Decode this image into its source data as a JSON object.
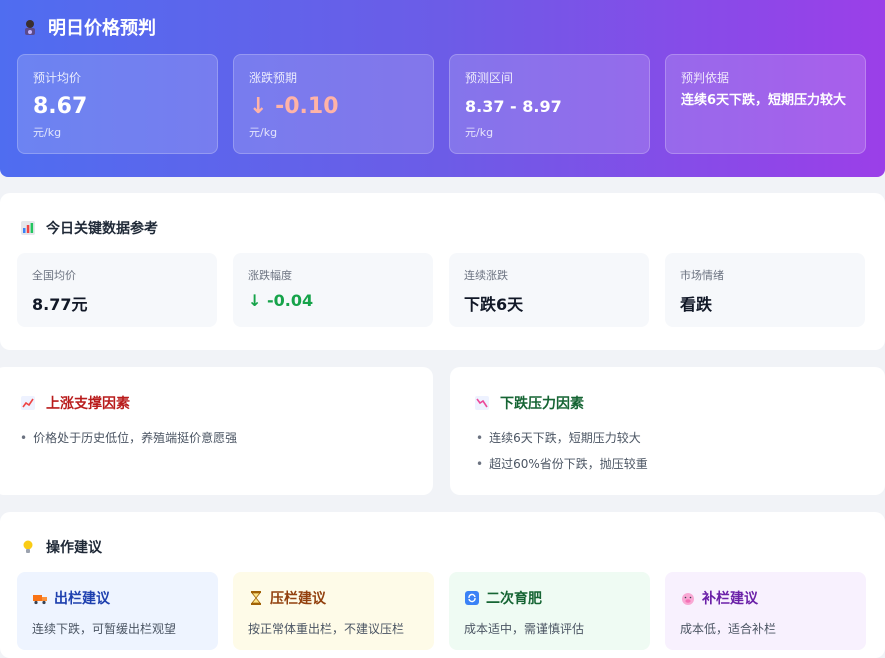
{
  "header": {
    "title": "明日价格预判",
    "cards": [
      {
        "label": "预计均价",
        "value": "8.67",
        "unit": "元/kg"
      },
      {
        "label": "涨跌预期",
        "value": "↓ -0.10",
        "unit": "元/kg"
      },
      {
        "label": "预测区间",
        "value": "8.37 - 8.97",
        "unit": "元/kg"
      },
      {
        "label": "预判依据",
        "value": "连续6天下跌，短期压力较大"
      }
    ]
  },
  "key_data": {
    "title": "今日关键数据参考",
    "items": [
      {
        "label": "全国均价",
        "value": "8.77元"
      },
      {
        "label": "涨跌幅度",
        "value": "↓ -0.04"
      },
      {
        "label": "连续涨跌",
        "value": "下跌6天"
      },
      {
        "label": "市场情绪",
        "value": "看跌"
      }
    ]
  },
  "up_factors": {
    "title": "上涨支撑因素",
    "items": [
      "价格处于历史低位，养殖端挺价意愿强"
    ]
  },
  "down_factors": {
    "title": "下跌压力因素",
    "items": [
      "连续6天下跌，短期压力较大",
      "超过60%省份下跌，抛压较重"
    ]
  },
  "advice": {
    "title": "操作建议",
    "cards": [
      {
        "title": "出栏建议",
        "desc": "连续下跌，可暂缓出栏观望",
        "color": "#1e40af",
        "bg": "#eef4ff"
      },
      {
        "title": "压栏建议",
        "desc": "按正常体重出栏，不建议压栏",
        "color": "#92400e",
        "bg": "#fefbe8"
      },
      {
        "title": "二次育肥",
        "desc": "成本适中，需谨慎评估",
        "color": "#166534",
        "bg": "#effbf3"
      },
      {
        "title": "补栏建议",
        "desc": "成本低，适合补栏",
        "color": "#6b21a8",
        "bg": "#f8f1fe"
      }
    ]
  },
  "colors": {
    "up_title": "#b91c1c",
    "down_title": "#166534",
    "down_value": "#16a34a"
  }
}
